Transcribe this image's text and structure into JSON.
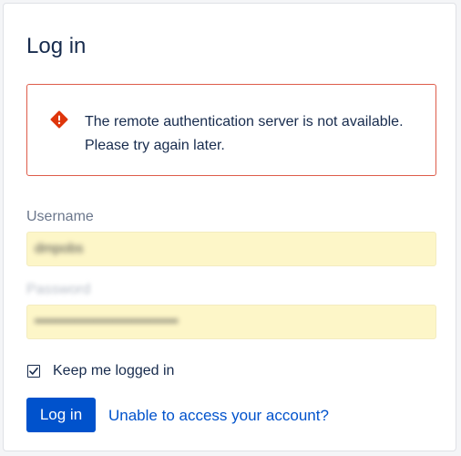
{
  "title": "Log in",
  "error": {
    "message": "The remote authentication server is not available. Please try again later.",
    "icon": "error-icon",
    "border_color": "#de5c4a",
    "icon_color": "#de350b"
  },
  "username": {
    "label": "Username",
    "value": "dmpobs"
  },
  "password": {
    "label": "Password",
    "value": "••••••••••••••••••••••••••••••"
  },
  "keep_logged_in": {
    "label": "Keep me logged in",
    "checked": true
  },
  "login_button": {
    "label": "Log in",
    "color": "#0052cc"
  },
  "help_link": {
    "label": "Unable to access your account?"
  }
}
